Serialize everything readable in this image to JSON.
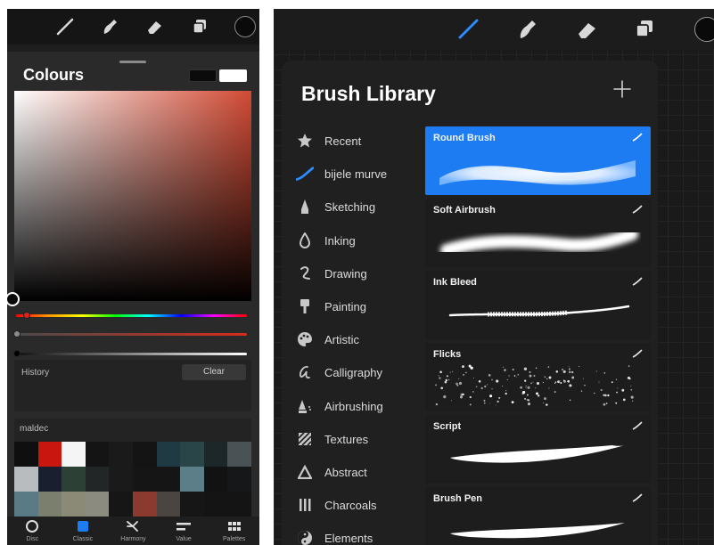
{
  "left_panel": {
    "toolbar": {
      "tools": [
        "brush-icon",
        "smudge-icon",
        "eraser-icon",
        "layers-icon"
      ],
      "current_color": "#0a0a0a"
    },
    "colours": {
      "title": "Colours",
      "primary_color": "#0b0b0b",
      "secondary_color": "#ffffff",
      "hue_color": "#d14a34",
      "history_label": "History",
      "clear_label": "Clear",
      "palette_name": "maldec",
      "palette_colors": [
        "#0f0f0f",
        "#c9160f",
        "#f5f5f5",
        "#141414",
        "#1a1a1a",
        "#141414",
        "#1f3a42",
        "#2a4547",
        "#1d2629",
        "#4a5256",
        "#b8bcbe",
        "#1a1f30",
        "#2c4035",
        "#232626",
        "#1a1a1a",
        "#151515",
        "#151515",
        "#5b7e88",
        "#121212",
        "#151719",
        "#5a7b86",
        "#7a7f6e",
        "#8a8a76",
        "#8c8b80",
        "#161616",
        "#8c3a2f",
        "#4a4540",
        "#161616",
        "#141414",
        "#141414"
      ]
    },
    "tabs": [
      {
        "label": "Disc",
        "icon": "disc-icon"
      },
      {
        "label": "Classic",
        "icon": "classic-icon"
      },
      {
        "label": "Harmony",
        "icon": "harmony-icon"
      },
      {
        "label": "Value",
        "icon": "value-icon"
      },
      {
        "label": "Palettes",
        "icon": "palettes-icon"
      }
    ],
    "active_tab": "Classic"
  },
  "right_panel": {
    "toolbar": {
      "tools": [
        "brush-icon",
        "smudge-icon",
        "eraser-icon",
        "layers-icon"
      ],
      "active_tool": "brush-icon",
      "accent": "#1e7cf2",
      "current_color": "#0a0a0a"
    },
    "library": {
      "title": "Brush Library",
      "add_icon": "plus-icon",
      "categories": [
        {
          "label": "Recent",
          "icon": "star-icon"
        },
        {
          "label": "bijele murve",
          "icon": "stroke-icon"
        },
        {
          "label": "Sketching",
          "icon": "pencil-icon"
        },
        {
          "label": "Inking",
          "icon": "ink-drop-icon"
        },
        {
          "label": "Drawing",
          "icon": "squiggle-icon"
        },
        {
          "label": "Painting",
          "icon": "paintbrush-icon"
        },
        {
          "label": "Artistic",
          "icon": "palette-icon"
        },
        {
          "label": "Calligraphy",
          "icon": "calligraphy-icon"
        },
        {
          "label": "Airbrushing",
          "icon": "airbrush-icon"
        },
        {
          "label": "Textures",
          "icon": "texture-icon"
        },
        {
          "label": "Abstract",
          "icon": "triangle-icon"
        },
        {
          "label": "Charcoals",
          "icon": "charcoal-icon"
        },
        {
          "label": "Elements",
          "icon": "yin-yang-icon"
        }
      ],
      "active_category": "bijele murve",
      "brushes": [
        {
          "name": "Round Brush",
          "style": "round"
        },
        {
          "name": "Soft Airbrush",
          "style": "soft"
        },
        {
          "name": "Ink Bleed",
          "style": "ink"
        },
        {
          "name": "Flicks",
          "style": "flicks"
        },
        {
          "name": "Script",
          "style": "script"
        },
        {
          "name": "Brush Pen",
          "style": "pen"
        }
      ],
      "selected_brush": "Round Brush"
    }
  }
}
